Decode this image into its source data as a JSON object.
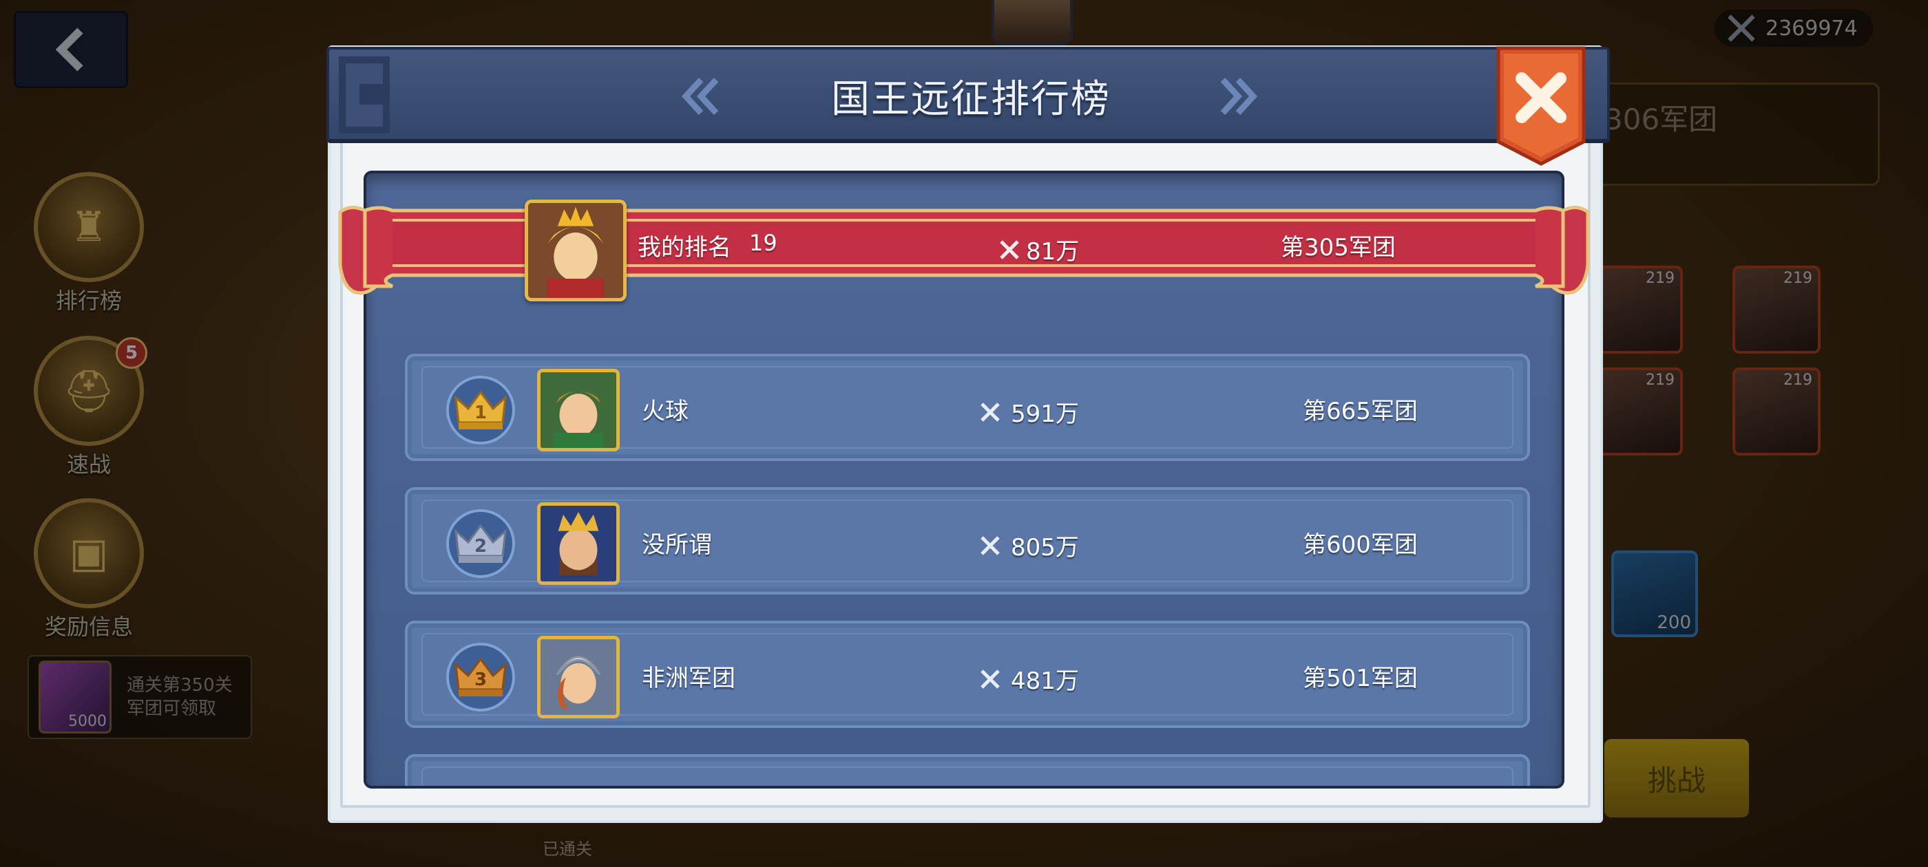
{
  "background": {
    "total_power": "2369974",
    "side_menu": [
      {
        "label": "排行榜",
        "icon": "trophy-icon"
      },
      {
        "label": "速战",
        "icon": "helmet-icon",
        "badge": "5"
      },
      {
        "label": "奖励信息",
        "icon": "chest-icon"
      }
    ],
    "reward_hint": {
      "line1": "通关第350关",
      "line2": "军团可领取",
      "amount": "5000"
    },
    "legion_name": "306军团",
    "hero_levels": [
      "219",
      "219",
      "219",
      "219"
    ],
    "item_count": "200",
    "challenge_label": "挑战",
    "cleared_label": "已通关"
  },
  "modal": {
    "title": "国王远征排行榜",
    "my_rank": {
      "label": "我的排名",
      "rank": "19",
      "power": "81万",
      "legion": "第305军团"
    },
    "rankings": [
      {
        "rank": "1",
        "name": "火球",
        "power": "591万",
        "legion": "第665军团",
        "crown_color": "#e8b53a"
      },
      {
        "rank": "2",
        "name": "没所谓",
        "power": "805万",
        "legion": "第600军团",
        "crown_color": "#aeb8d0"
      },
      {
        "rank": "3",
        "name": "非洲军团",
        "power": "481万",
        "legion": "第501军团",
        "crown_color": "#d9913a"
      }
    ]
  }
}
